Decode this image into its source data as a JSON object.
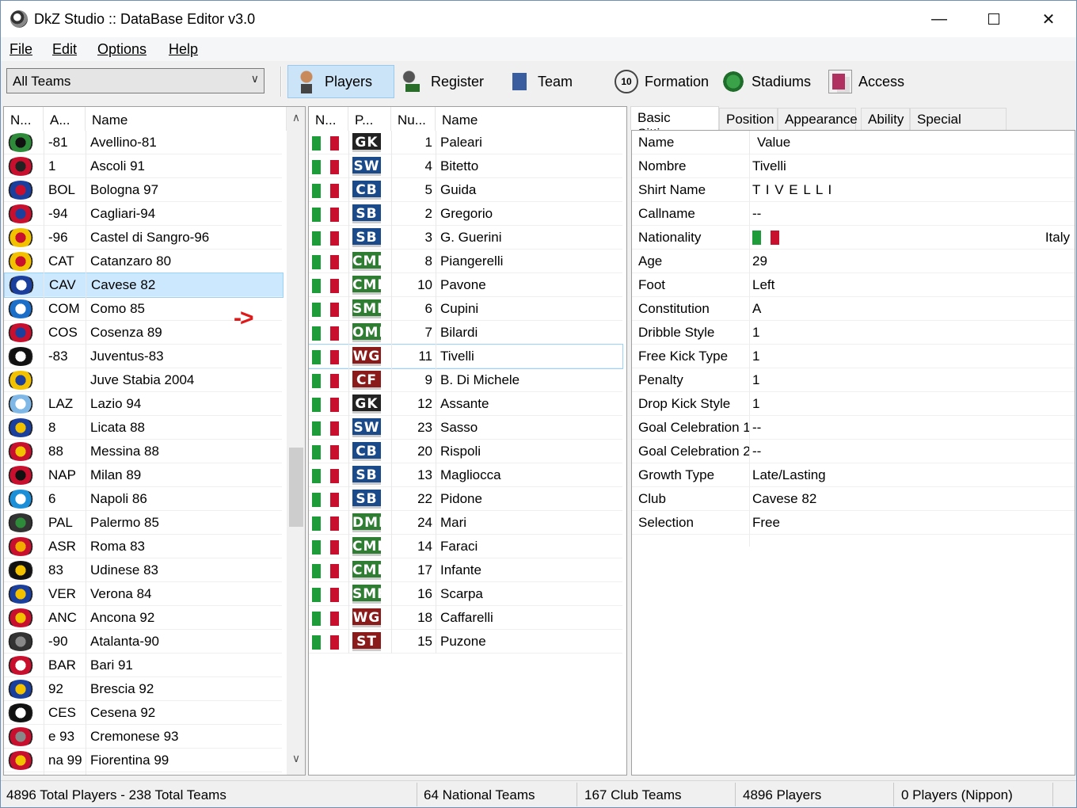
{
  "window": {
    "title": "DkZ Studio :: DataBase Editor v3.0"
  },
  "menu": [
    {
      "label": "File"
    },
    {
      "label": "Edit"
    },
    {
      "label": "Options"
    },
    {
      "label": "Help"
    }
  ],
  "toolbar": {
    "team_filter": "All Teams",
    "buttons": [
      {
        "label": "Players",
        "icon": "player-icon",
        "active": true
      },
      {
        "label": "Register",
        "icon": "register-icon"
      },
      {
        "label": "Team",
        "icon": "team-icon"
      },
      {
        "label": "Formation",
        "icon": "formation-icon",
        "icon_text": "10"
      },
      {
        "label": "Stadiums",
        "icon": "stadium-icon"
      },
      {
        "label": "Access",
        "icon": "access-icon"
      }
    ]
  },
  "teams": {
    "headers": [
      "N...",
      "A...",
      "Name"
    ],
    "arrow_annotation": "->",
    "rows": [
      {
        "abbr": "-81",
        "name": "Avellino-81",
        "c1": "#2e8b3a",
        "c2": "#111"
      },
      {
        "abbr": "1",
        "name": "Ascoli 91",
        "c1": "#c8102e",
        "c2": "#222"
      },
      {
        "abbr": "BOL",
        "name": "Bologna 97",
        "c1": "#1b3f9c",
        "c2": "#c8102e"
      },
      {
        "abbr": "-94",
        "name": "Cagliari-94",
        "c1": "#c8102e",
        "c2": "#1b3f9c"
      },
      {
        "abbr": "-96",
        "name": "Castel di Sangro-96",
        "c1": "#f2c200",
        "c2": "#c8102e"
      },
      {
        "abbr": "CAT",
        "name": "Catanzaro 80",
        "c1": "#f2c200",
        "c2": "#c8102e"
      },
      {
        "abbr": "CAV",
        "name": "Cavese 82",
        "c1": "#1b3f9c",
        "c2": "#ffffff",
        "selected": true
      },
      {
        "abbr": "COM",
        "name": "Como 85",
        "c1": "#1b6fc8",
        "c2": "#ffffff"
      },
      {
        "abbr": "COS",
        "name": "Cosenza 89",
        "c1": "#c8102e",
        "c2": "#1b3f9c"
      },
      {
        "abbr": "-83",
        "name": "Juventus-83",
        "c1": "#111",
        "c2": "#ffffff"
      },
      {
        "abbr": "",
        "name": "Juve Stabia 2004",
        "c1": "#f2c200",
        "c2": "#1b3f9c"
      },
      {
        "abbr": "LAZ",
        "name": "Lazio 94",
        "c1": "#7fb8e6",
        "c2": "#ffffff"
      },
      {
        "abbr": "8",
        "name": "Licata 88",
        "c1": "#1b3f9c",
        "c2": "#f2c200"
      },
      {
        "abbr": "88",
        "name": "Messina 88",
        "c1": "#c8102e",
        "c2": "#f2c200"
      },
      {
        "abbr": "NAP",
        "name": "Milan 89",
        "c1": "#c8102e",
        "c2": "#111"
      },
      {
        "abbr": "6",
        "name": "Napoli 86",
        "c1": "#1b8fd8",
        "c2": "#ffffff"
      },
      {
        "abbr": "PAL",
        "name": "Palermo 85",
        "c1": "#333",
        "c2": "#2e8b3a"
      },
      {
        "abbr": "ASR",
        "name": "Roma 83",
        "c1": "#c8102e",
        "c2": "#f2a900"
      },
      {
        "abbr": "83",
        "name": "Udinese 83",
        "c1": "#111",
        "c2": "#f2c200"
      },
      {
        "abbr": "VER",
        "name": "Verona 84",
        "c1": "#1b3f9c",
        "c2": "#f2c200"
      },
      {
        "abbr": "ANC",
        "name": "Ancona 92",
        "c1": "#c8102e",
        "c2": "#f2c200"
      },
      {
        "abbr": "-90",
        "name": "Atalanta-90",
        "c1": "#333",
        "c2": "#888"
      },
      {
        "abbr": "BAR",
        "name": "Bari 91",
        "c1": "#c8102e",
        "c2": "#ffffff"
      },
      {
        "abbr": "92",
        "name": "Brescia 92",
        "c1": "#1b3f9c",
        "c2": "#f2c200"
      },
      {
        "abbr": "CES",
        "name": "Cesena 92",
        "c1": "#111",
        "c2": "#ffffff"
      },
      {
        "abbr": "e 93",
        "name": "Cremonese 93",
        "c1": "#c8102e",
        "c2": "#888"
      },
      {
        "abbr": "na 99",
        "name": "Fiorentina 99",
        "c1": "#c8102e",
        "c2": "#f2c200"
      }
    ]
  },
  "players": {
    "headers": [
      "N...",
      "P...",
      "Nu...",
      "Name"
    ],
    "rows": [
      {
        "pos": "GK",
        "pos_color": "#222",
        "num": "1",
        "name": "Paleari"
      },
      {
        "pos": "SW",
        "pos_color": "#1a4a8a",
        "num": "4",
        "name": "Bitetto"
      },
      {
        "pos": "CB",
        "pos_color": "#1a4a8a",
        "num": "5",
        "name": "Guida"
      },
      {
        "pos": "SB",
        "pos_color": "#1a4a8a",
        "num": "2",
        "name": "Gregorio"
      },
      {
        "pos": "SB",
        "pos_color": "#1a4a8a",
        "num": "3",
        "name": "G. Guerini"
      },
      {
        "pos": "CMF",
        "pos_color": "#2e7d32",
        "num": "8",
        "name": "Piangerelli"
      },
      {
        "pos": "CMF",
        "pos_color": "#2e7d32",
        "num": "10",
        "name": "Pavone"
      },
      {
        "pos": "SMF",
        "pos_color": "#2e7d32",
        "num": "6",
        "name": "Cupini"
      },
      {
        "pos": "OMF",
        "pos_color": "#2e7d32",
        "num": "7",
        "name": "Bilardi"
      },
      {
        "pos": "WG",
        "pos_color": "#8b1a1a",
        "num": "11",
        "name": "Tivelli",
        "selected": true
      },
      {
        "pos": "CF",
        "pos_color": "#8b1a1a",
        "num": "9",
        "name": "B. Di Michele"
      },
      {
        "pos": "GK",
        "pos_color": "#222",
        "num": "12",
        "name": "Assante"
      },
      {
        "pos": "SW",
        "pos_color": "#1a4a8a",
        "num": "23",
        "name": "Sasso"
      },
      {
        "pos": "CB",
        "pos_color": "#1a4a8a",
        "num": "20",
        "name": "Rispoli"
      },
      {
        "pos": "SB",
        "pos_color": "#1a4a8a",
        "num": "13",
        "name": "Magliocca"
      },
      {
        "pos": "SB",
        "pos_color": "#1a4a8a",
        "num": "22",
        "name": "Pidone"
      },
      {
        "pos": "DMF",
        "pos_color": "#2e7d32",
        "num": "24",
        "name": "Mari"
      },
      {
        "pos": "CMF",
        "pos_color": "#2e7d32",
        "num": "14",
        "name": "Faraci"
      },
      {
        "pos": "CMF",
        "pos_color": "#2e7d32",
        "num": "17",
        "name": "Infante"
      },
      {
        "pos": "SMF",
        "pos_color": "#2e7d32",
        "num": "16",
        "name": "Scarpa"
      },
      {
        "pos": "WG",
        "pos_color": "#8b1a1a",
        "num": "18",
        "name": "Caffarelli"
      },
      {
        "pos": "ST",
        "pos_color": "#8b1a1a",
        "num": "15",
        "name": "Puzone"
      }
    ],
    "flag_colors": [
      "#1e9c3a",
      "#ffffff",
      "#c8102e"
    ]
  },
  "details": {
    "tabs": [
      {
        "label": "Basic Sittings",
        "active": true
      },
      {
        "label": "Position"
      },
      {
        "label": "Appearance"
      },
      {
        "label": "Ability"
      },
      {
        "label": "Special Abilities"
      }
    ],
    "header": {
      "key": "Name",
      "value": "Value"
    },
    "properties": [
      {
        "key": "Nombre",
        "value": "Tivelli"
      },
      {
        "key": "Shirt Name",
        "value": "T I V E L L I"
      },
      {
        "key": "Callname",
        "value": "--"
      },
      {
        "key": "Nationality",
        "value": "",
        "flag": true,
        "extra": "Italy"
      },
      {
        "key": "Age",
        "value": "29"
      },
      {
        "key": "Foot",
        "value": "Left"
      },
      {
        "key": "Constitution",
        "value": "A"
      },
      {
        "key": "Dribble Style",
        "value": "1"
      },
      {
        "key": "Free Kick Type",
        "value": "1"
      },
      {
        "key": "Penalty",
        "value": "1"
      },
      {
        "key": "Drop Kick Style",
        "value": "1"
      },
      {
        "key": "Goal Celebration 1",
        "value": "--"
      },
      {
        "key": "Goal Celebration 2",
        "value": "--"
      },
      {
        "key": "Growth Type",
        "value": "Late/Lasting"
      },
      {
        "key": "Club",
        "value": "Cavese 82"
      },
      {
        "key": "Selection",
        "value": "Free"
      }
    ]
  },
  "status": {
    "items": [
      "4896 Total Players  -  238 Total Teams",
      "64 National Teams",
      "167 Club Teams",
      "4896 Players",
      "0 Players (Nippon)"
    ]
  }
}
